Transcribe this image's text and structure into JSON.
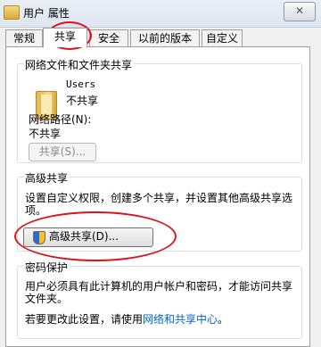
{
  "window": {
    "title": "用户 属性",
    "close_label": "✕"
  },
  "tabs": [
    {
      "label": "常规"
    },
    {
      "label": "共享"
    },
    {
      "label": "安全"
    },
    {
      "label": "以前的版本"
    },
    {
      "label": "自定义"
    }
  ],
  "network_sharing": {
    "group_title": "网络文件和文件夹共享",
    "folder_name": "Users",
    "share_status": "不共享",
    "path_label": "网络路径(N):",
    "path_value": "不共享",
    "share_button": "共享(S)..."
  },
  "advanced_sharing": {
    "group_title": "高级共享",
    "description_line1": "设置自定义权限，创建多个共享，并设置其他高级共享选",
    "description_line2": "项。",
    "button_label": "高级共享(D)..."
  },
  "password_protection": {
    "group_title": "密码保护",
    "description_line1": "用户必须具有此计算机的用户帐户和密码，才能访问共享",
    "description_line2": "文件夹。",
    "change_prefix": "若要更改此设置，请使用",
    "link_text": "网络和共享中心",
    "change_suffix": "。"
  },
  "colors": {
    "annotation_red": "#d9141b",
    "link_blue": "#0066cc"
  }
}
